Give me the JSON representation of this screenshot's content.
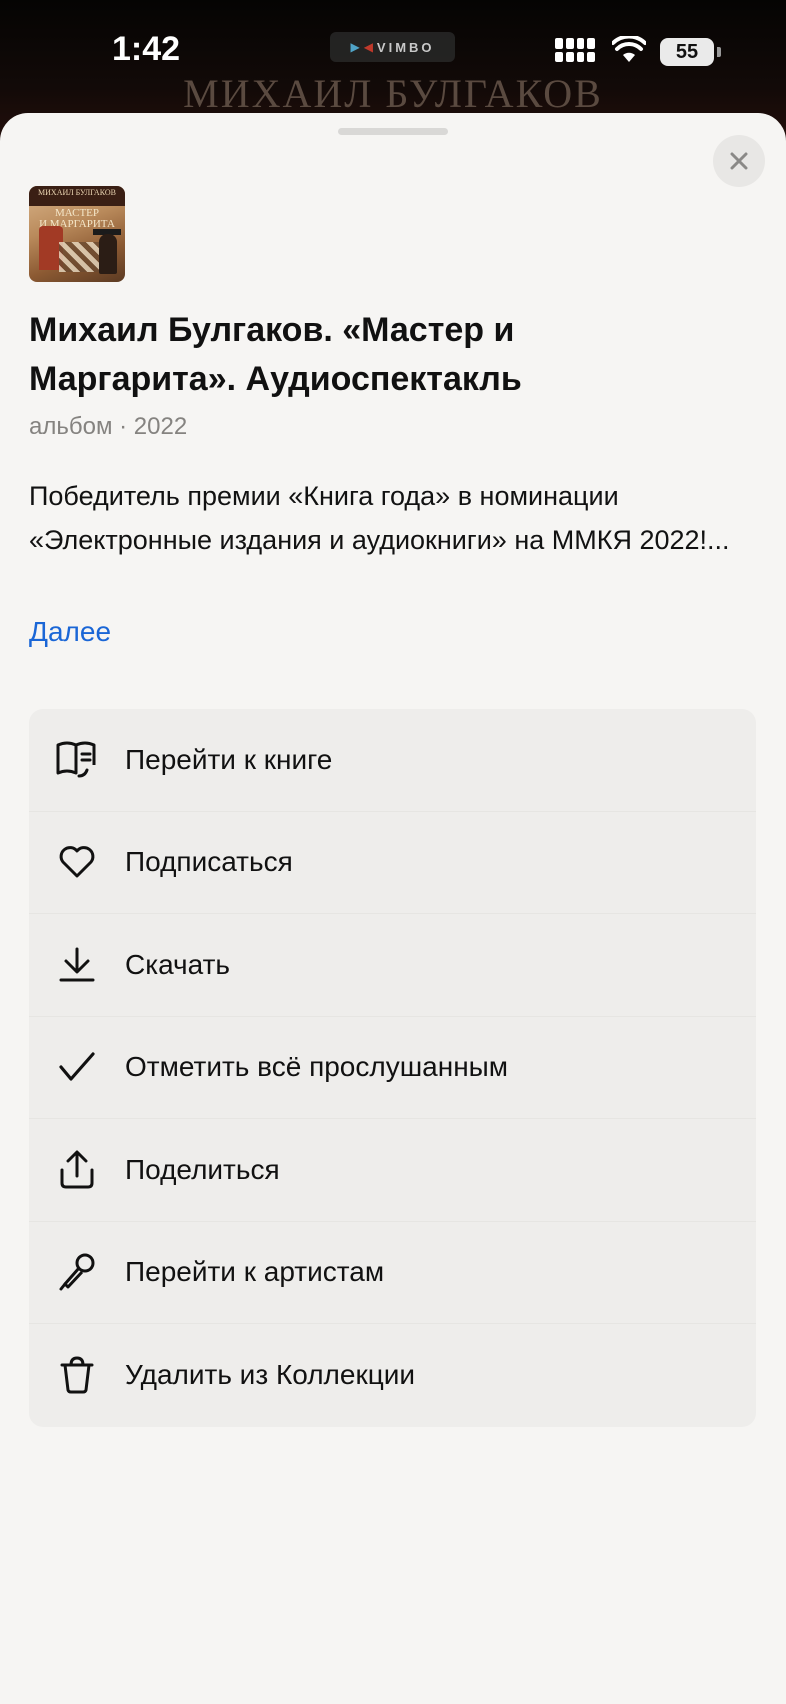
{
  "status_bar": {
    "time": "1:42",
    "recorder_label": "VIMBO",
    "battery": "55"
  },
  "backdrop": {
    "title": "МИХАИЛ БУЛГАКОВ"
  },
  "sheet": {
    "cover_icon": "album-cover",
    "cover": {
      "author": "МИХАИЛ БУЛГАКОВ",
      "title_line1": "МАСТЕР",
      "title_line2": "И МАРГАРИТА"
    },
    "title": "Михаил Булгаков. «Мастер и Маргарита». Аудиоспектакль",
    "meta": "альбом · 2022",
    "description": "Победитель премии «Книга года» в номинации «Электронные издания и аудиокниги» на ММКЯ 2022!...",
    "more_link": "Далее",
    "accent_color": "#1a66d6"
  },
  "menu": {
    "items": [
      {
        "label": "Перейти к книге",
        "icon": "book-icon"
      },
      {
        "label": "Подписаться",
        "icon": "heart-icon"
      },
      {
        "label": "Скачать",
        "icon": "download-icon"
      },
      {
        "label": "Отметить всё прослушанным",
        "icon": "check-icon"
      },
      {
        "label": "Поделиться",
        "icon": "share-icon"
      },
      {
        "label": "Перейти к артистам",
        "icon": "microphone-icon"
      },
      {
        "label": "Удалить из Коллекции",
        "icon": "trash-icon"
      }
    ]
  }
}
